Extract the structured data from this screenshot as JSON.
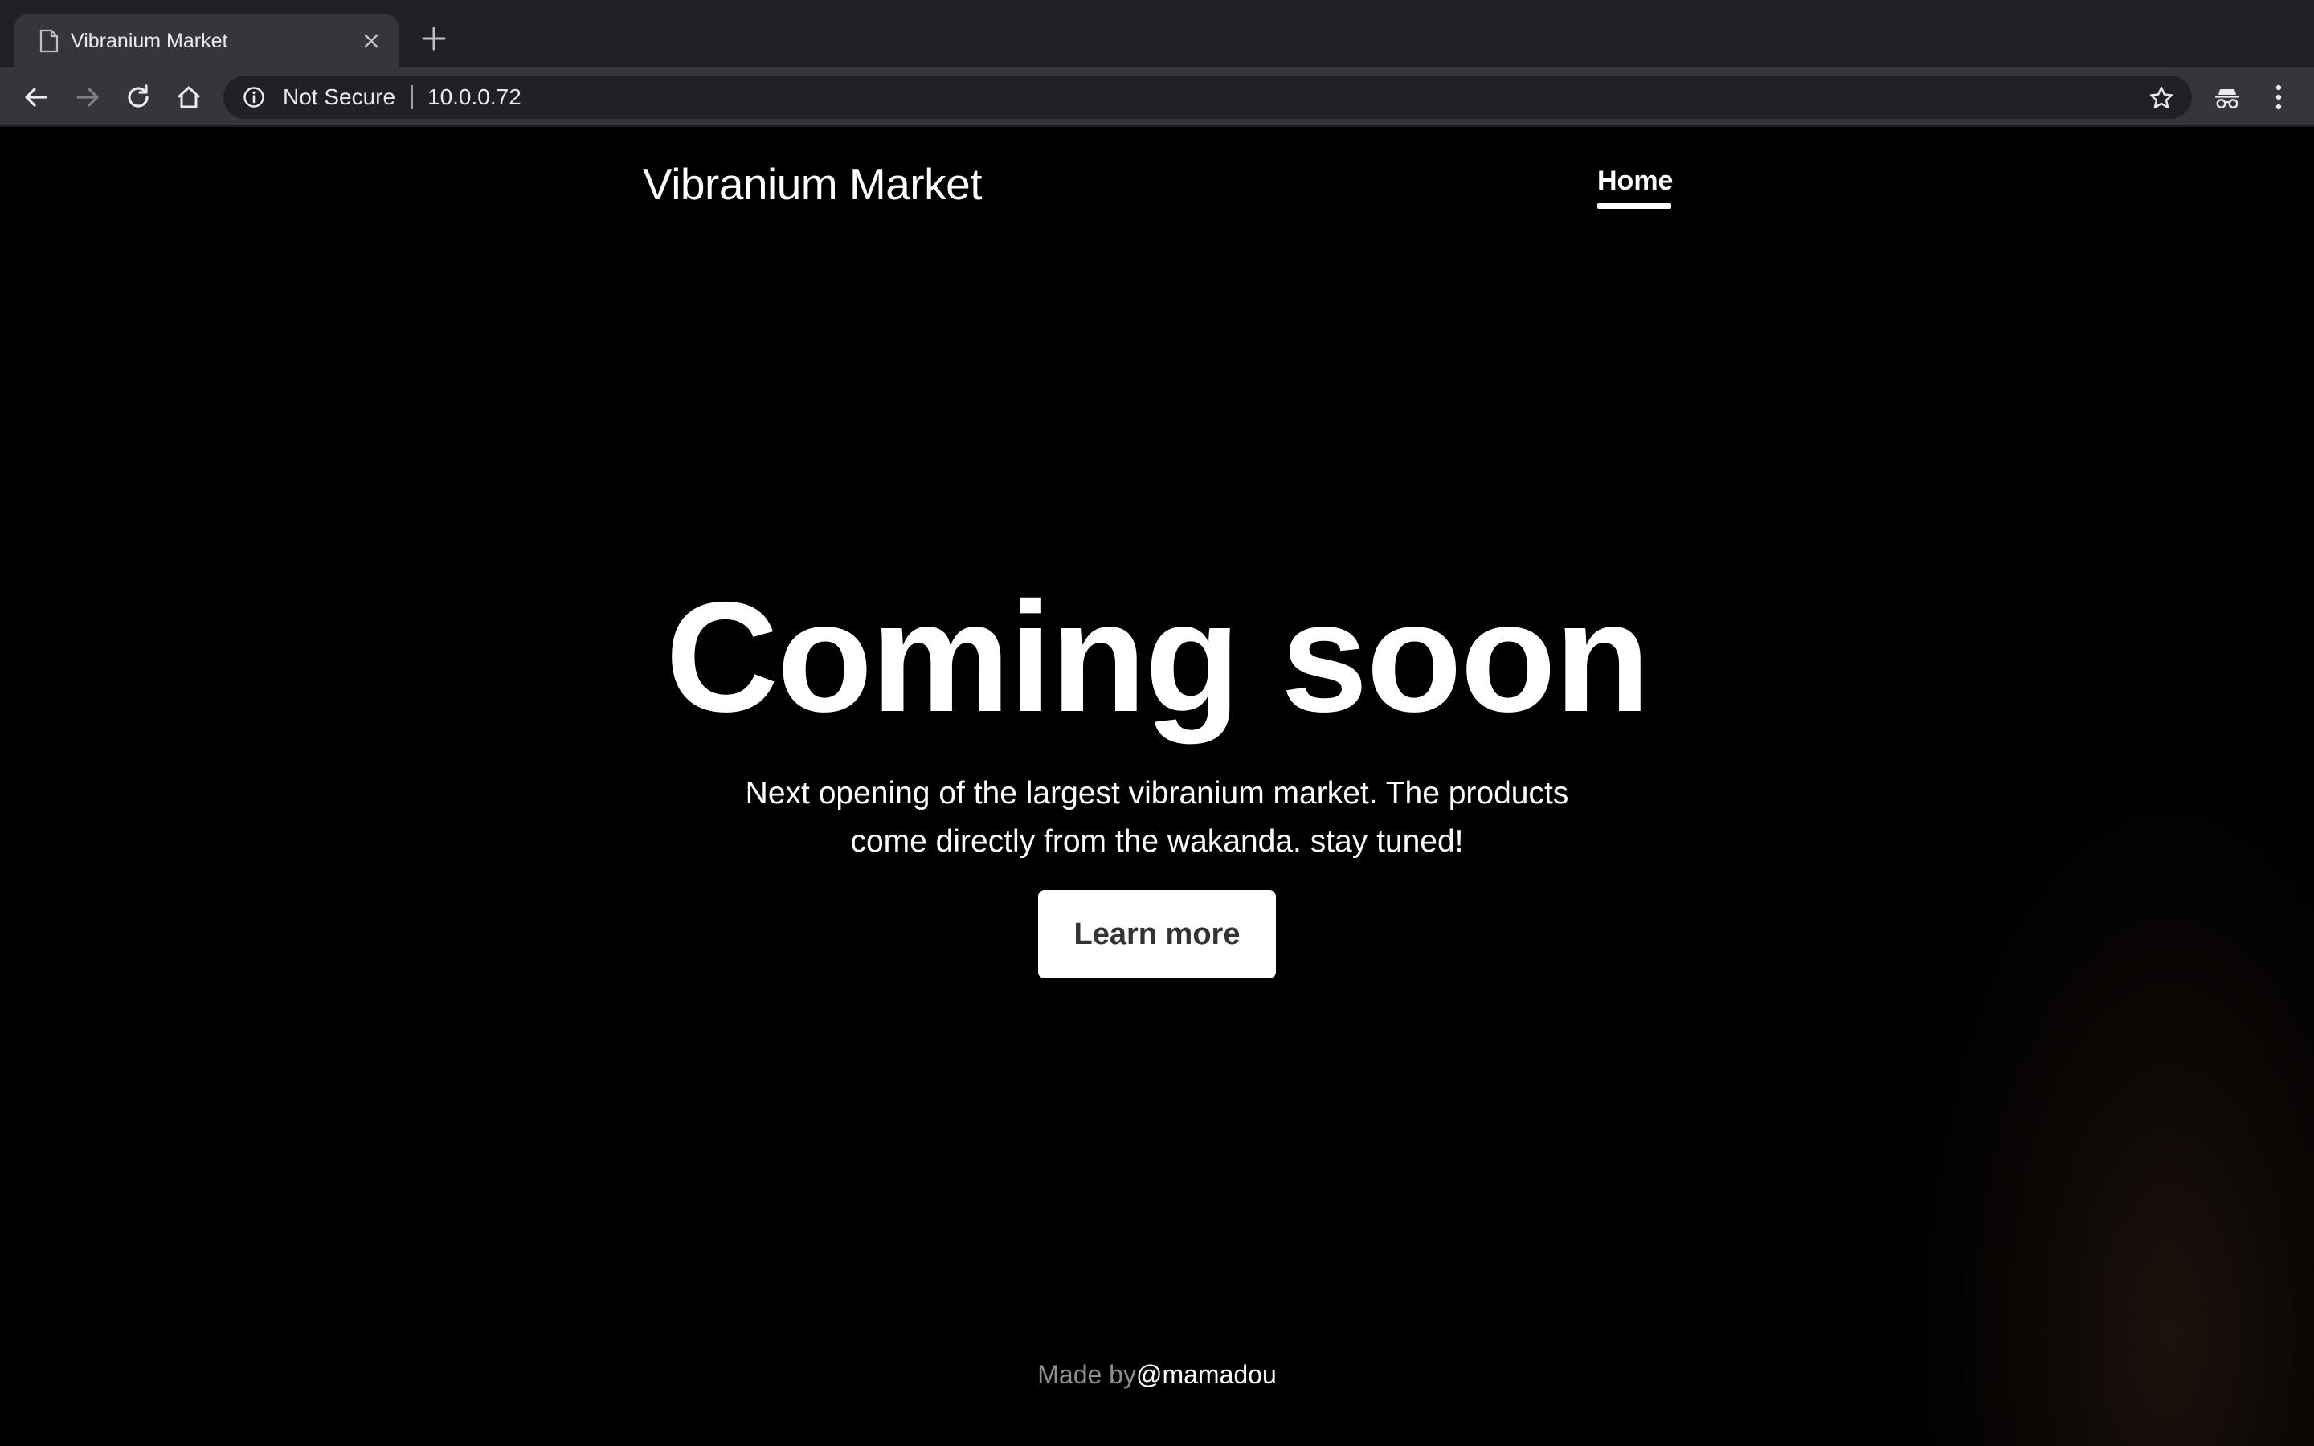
{
  "browser": {
    "tab_title": "Vibranium Market",
    "security_label": "Not Secure",
    "url": "10.0.0.72",
    "icons": [
      "document-icon",
      "close-icon",
      "new-tab-icon",
      "back-icon",
      "forward-icon",
      "reload-icon",
      "home-icon",
      "info-icon",
      "star-icon",
      "incognito-icon",
      "menu-icon"
    ]
  },
  "header": {
    "brand": "Vibranium Market",
    "nav": [
      {
        "label": "Home",
        "active": true
      }
    ]
  },
  "hero": {
    "title": "Coming soon",
    "lead": "Next opening of the largest vibranium market. The products come directly from the wakanda. stay tuned!",
    "button_label": "Learn more"
  },
  "footer": {
    "made_by": "Made by",
    "author": "@mamadou"
  },
  "colors": {
    "chrome_dark": "#202124",
    "chrome_toolbar": "#35363a",
    "page_background": "#000000",
    "text": "#ffffff",
    "button_text": "#333333",
    "footer_muted": "#8e8e8e"
  }
}
